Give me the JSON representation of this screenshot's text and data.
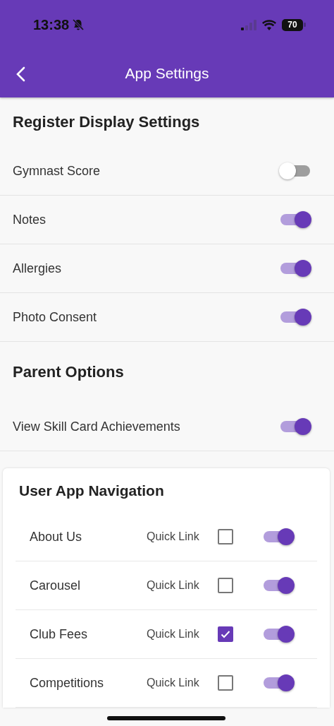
{
  "status_bar": {
    "time": "13:38",
    "battery": "70"
  },
  "app_bar": {
    "title": "App Settings"
  },
  "sections": [
    {
      "title": "Register Display Settings",
      "items": [
        {
          "label": "Gymnast Score",
          "on": false
        },
        {
          "label": "Notes",
          "on": true
        },
        {
          "label": "Allergies",
          "on": true
        },
        {
          "label": "Photo Consent",
          "on": true
        }
      ]
    },
    {
      "title": "Parent Options",
      "items": [
        {
          "label": "View Skill Card Achievements",
          "on": true
        }
      ]
    }
  ],
  "navigation": {
    "title": "User App Navigation",
    "items": [
      {
        "label": "About Us",
        "quick_link_label": "Quick Link",
        "quick_link": false,
        "on": true
      },
      {
        "label": "Carousel",
        "quick_link_label": "Quick Link",
        "quick_link": false,
        "on": true
      },
      {
        "label": "Club Fees",
        "quick_link_label": "Quick Link",
        "quick_link": true,
        "on": true
      },
      {
        "label": "Competitions",
        "quick_link_label": "Quick Link",
        "quick_link": false,
        "on": true
      }
    ]
  }
}
